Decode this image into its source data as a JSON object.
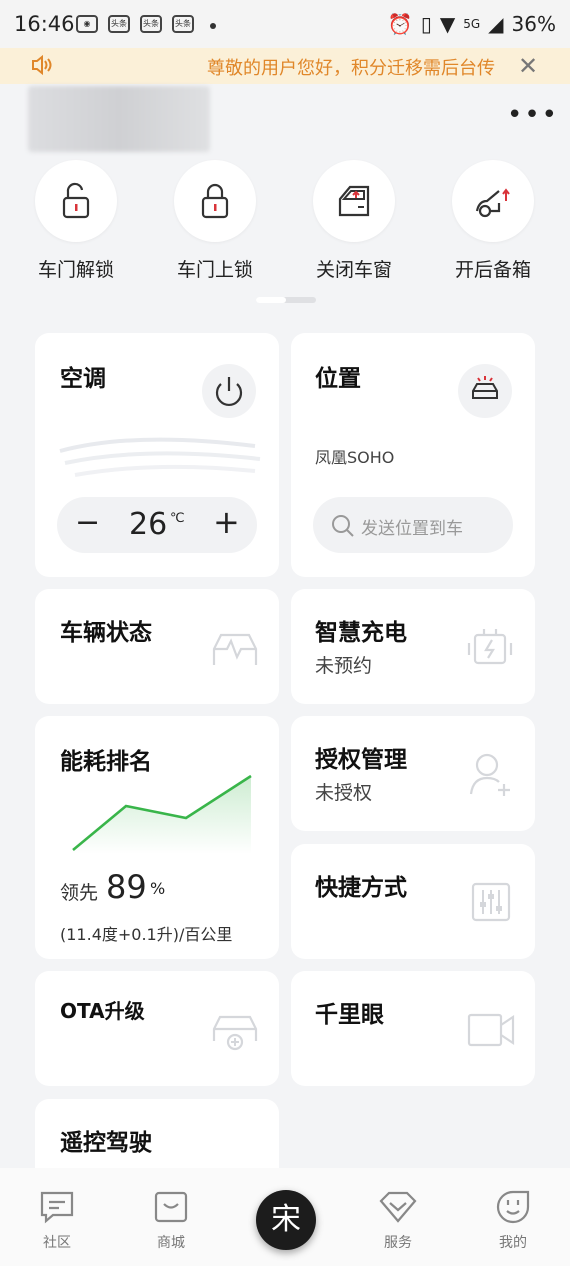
{
  "status_bar": {
    "time": "16:46",
    "notif_icons": [
      "头条",
      "头条",
      "头条"
    ],
    "network": "5G",
    "battery": "36%"
  },
  "banner": {
    "text": "尊敬的用户您好，积分迁移需后台传",
    "accent": "#e0872a"
  },
  "quick_actions": [
    {
      "label": "车门解锁",
      "icon": "unlock-icon"
    },
    {
      "label": "车门上锁",
      "icon": "lock-icon"
    },
    {
      "label": "关闭车窗",
      "icon": "car-window-icon"
    },
    {
      "label": "开后备箱",
      "icon": "trunk-icon"
    }
  ],
  "cards": {
    "ac": {
      "title": "空调",
      "temp": "26",
      "unit": "℃",
      "minus": "−",
      "plus": "+"
    },
    "location": {
      "title": "位置",
      "place": "凤凰SOHO",
      "send_placeholder": "发送位置到车"
    },
    "vehicle_status": {
      "title": "车辆状态"
    },
    "smart_charge": {
      "title": "智慧充电",
      "sub": "未预约"
    },
    "energy": {
      "title": "能耗排名",
      "lead_label": "领先",
      "lead_value": "89",
      "lead_unit": "%",
      "detail": "(11.4度+0.1升)/百公里"
    },
    "auth": {
      "title": "授权管理",
      "sub": "未授权"
    },
    "shortcut": {
      "title": "快捷方式"
    },
    "ota": {
      "title": "OTA升级"
    },
    "camera": {
      "title": "千里眼"
    },
    "remote": {
      "title": "遥控驾驶"
    }
  },
  "nav": {
    "community": "社区",
    "mall": "商城",
    "center": "宋",
    "service": "服务",
    "mine": "我的"
  },
  "colors": {
    "accent_red": "#d9343a",
    "chart_green": "#39b54a"
  }
}
